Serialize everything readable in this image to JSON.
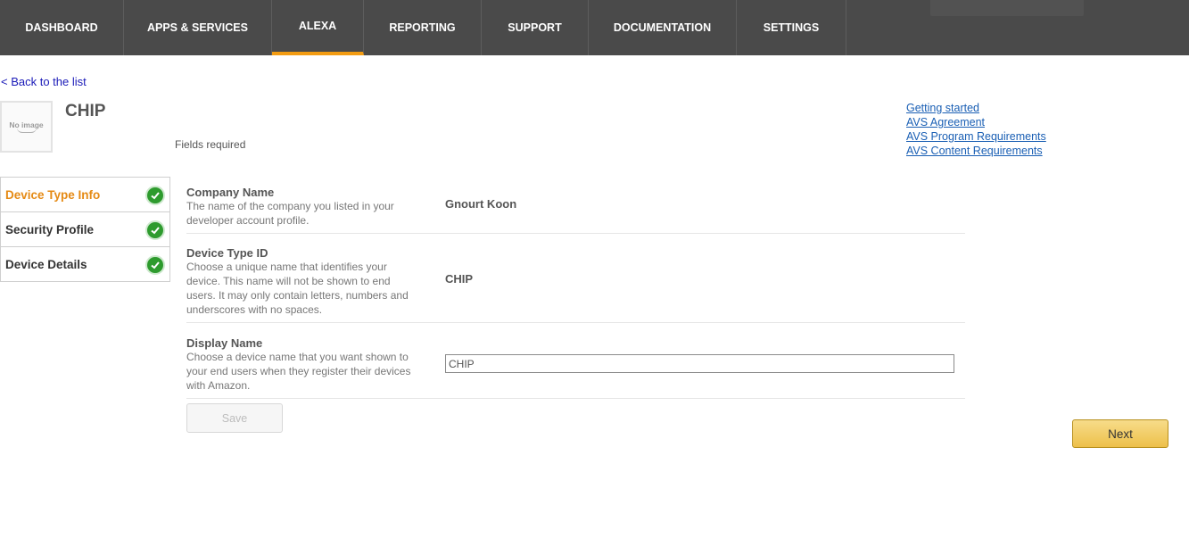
{
  "nav": {
    "tabs": [
      {
        "label": "DASHBOARD"
      },
      {
        "label": "APPS & SERVICES"
      },
      {
        "label": "ALEXA"
      },
      {
        "label": "REPORTING"
      },
      {
        "label": "SUPPORT"
      },
      {
        "label": "DOCUMENTATION"
      },
      {
        "label": "SETTINGS"
      }
    ],
    "active_tab": "ALEXA",
    "active_color": "#f39c12"
  },
  "back_link": "< Back to the list",
  "device": {
    "image_placeholder": "No image",
    "title": "CHIP",
    "fields_required": "Fields required"
  },
  "help_links": [
    {
      "label": "Getting started"
    },
    {
      "label": "AVS Agreement"
    },
    {
      "label": "AVS Program Requirements"
    },
    {
      "label": "AVS Content Requirements"
    }
  ],
  "steps": [
    {
      "label": "Device Type Info",
      "status": "complete",
      "icon": "check-icon"
    },
    {
      "label": "Security Profile",
      "status": "complete",
      "icon": "check-icon"
    },
    {
      "label": "Device Details",
      "status": "complete",
      "icon": "check-icon"
    }
  ],
  "form": {
    "company": {
      "label": "Company Name",
      "description": "The name of the company you listed in your developer account profile.",
      "value": "Gnourt Koon"
    },
    "device_type_id": {
      "label": "Device Type ID",
      "description": "Choose a unique name that identifies your device. This name will not be shown to end users. It may only contain letters, numbers and underscores with no spaces.",
      "value": "CHIP"
    },
    "display_name": {
      "label": "Display Name",
      "description": "Choose a device name that you want shown to your end users when they register their devices with Amazon.",
      "value": "CHIP"
    }
  },
  "buttons": {
    "save": "Save",
    "next": "Next"
  }
}
